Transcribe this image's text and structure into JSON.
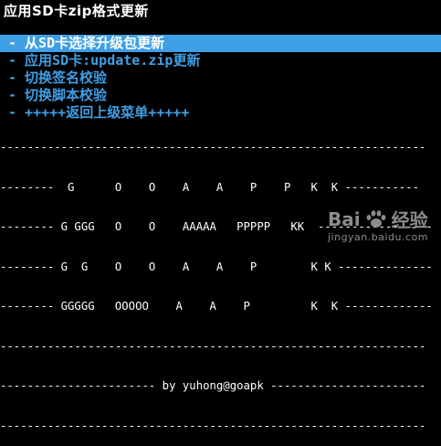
{
  "title": "应用SD卡zip格式更新",
  "menu": {
    "items": [
      {
        "label": "- 从SD卡选择升级包更新",
        "selected": true
      },
      {
        "label": "- 应用SD卡:update.zip更新",
        "selected": false
      },
      {
        "label": "- 切换签名校验",
        "selected": false
      },
      {
        "label": "- 切换脚本校验",
        "selected": false
      },
      {
        "label": "- +++++返回上级菜单+++++",
        "selected": false
      }
    ]
  },
  "art": {
    "lines": [
      "---------------------------------------------------------------",
      "--------  G      O    O    A    A    P    P   K  K -----------",
      "-------- G GGG   O    O    AAAAA   PPPPP   KK  -----------------",
      "-------- G  G    O    O    A    A    P        K K --------------",
      "-------- GGGGG   OOOOO    A    A    P         K  K -------------",
      "---------------------------------------------------------------",
      "----------------------- by yuhong@goapk -----------------------",
      "---------------------------------------------------------------"
    ]
  },
  "watermark": {
    "brand": "Bai",
    "brand_suffix": "经验",
    "sub": "jingyan.baidu.com"
  }
}
